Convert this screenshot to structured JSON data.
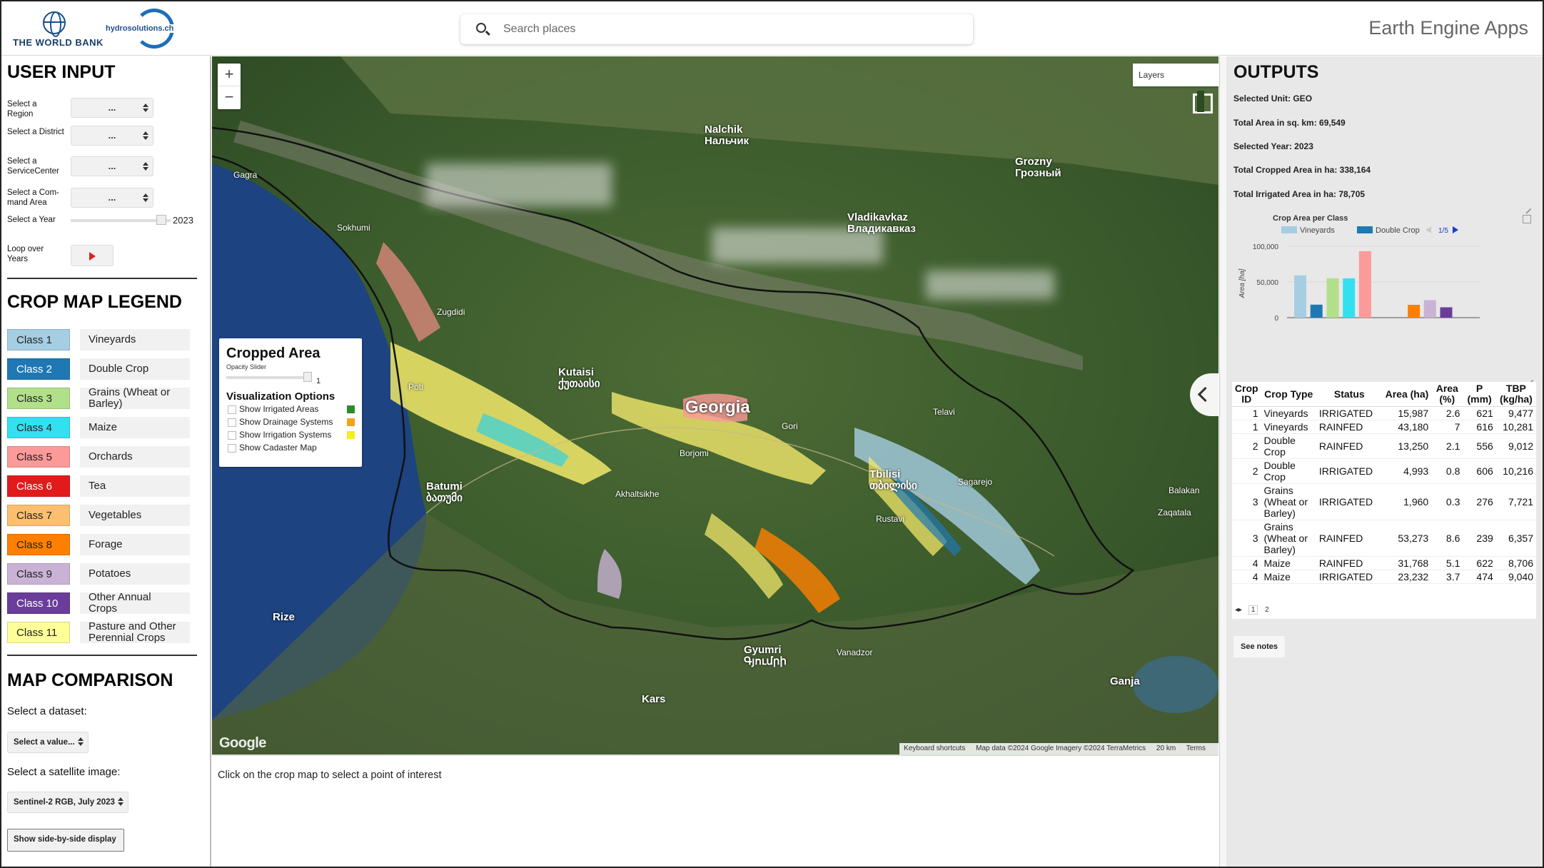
{
  "header": {
    "org1": "THE WORLD BANK",
    "org2": "hydrosolutions.ch",
    "search_placeholder": "Search places",
    "app_title": "Earth Engine Apps"
  },
  "user_input": {
    "title": "USER INPUT",
    "region_label": "Select a Region",
    "region_value": "...",
    "district_label": "Select a District",
    "district_value": "...",
    "service_label": "Select a ServiceCenter",
    "service_value": "...",
    "command_label": "Select a Com-mand Area",
    "command_value": "...",
    "year_label": "Select a Year",
    "year_value": "2023",
    "loop_label": "Loop over Years"
  },
  "legend": {
    "title": "CROP MAP LEGEND",
    "items": [
      {
        "cls": "Class 1",
        "name": "Vineyards",
        "color": "#a6cee3",
        "text_color": "#222"
      },
      {
        "cls": "Class 2",
        "name": "Double Crop",
        "color": "#1f78b4",
        "text_color": "#fff"
      },
      {
        "cls": "Class 3",
        "name": "Grains (Wheat or Barley)",
        "color": "#b2df8a",
        "text_color": "#222"
      },
      {
        "cls": "Class 4",
        "name": "Maize",
        "color": "#33e0f0",
        "text_color": "#222"
      },
      {
        "cls": "Class 5",
        "name": "Orchards",
        "color": "#fb9a99",
        "text_color": "#222"
      },
      {
        "cls": "Class 6",
        "name": "Tea",
        "color": "#e31a1c",
        "text_color": "#fff"
      },
      {
        "cls": "Class 7",
        "name": "Vegetables",
        "color": "#fdbf6f",
        "text_color": "#222"
      },
      {
        "cls": "Class 8",
        "name": "Forage",
        "color": "#ff7f00",
        "text_color": "#222"
      },
      {
        "cls": "Class 9",
        "name": "Potatoes",
        "color": "#cab2d6",
        "text_color": "#222"
      },
      {
        "cls": "Class 10",
        "name": "Other Annual Crops",
        "color": "#6a3d9a",
        "text_color": "#fff"
      },
      {
        "cls": "Class 11",
        "name": "Pasture and Other Perennial Crops",
        "color": "#ffff99",
        "text_color": "#222"
      }
    ]
  },
  "comparison": {
    "title": "MAP COMPARISON",
    "dataset_label": "Select a dataset:",
    "dataset_value": "Select a value...",
    "satellite_label": "Select a satellite image:",
    "satellite_value": "Sentinel-2 RGB, July 2023",
    "button": "Show side-by-side display"
  },
  "map": {
    "layers_label": "Layers",
    "country": "Georgia",
    "google": "Google",
    "attribution": [
      "Keyboard shortcuts",
      "Map data ©2024 Google Imagery ©2024 TerraMetrics",
      "20 km",
      "Terms"
    ],
    "cities": [
      {
        "name": "Kutaisi\nქუთაისი",
        "big": true
      },
      {
        "name": "Tbilisi\nთბილისი",
        "big": true
      },
      {
        "name": "Batumi\nბათუმი",
        "big": true
      },
      {
        "name": "Nalchik\nНальчик",
        "big": true
      },
      {
        "name": "Vladikavkaz\nВладикавказ",
        "big": true
      },
      {
        "name": "Grozny\nГрозный",
        "big": true
      },
      {
        "name": "Gyumri\nԳյումրի",
        "big": true
      },
      {
        "name": "Kars",
        "big": true
      },
      {
        "name": "Ganja",
        "big": true
      },
      {
        "name": "Rize",
        "big": true
      },
      {
        "name": "Sokhumi",
        "big": false
      },
      {
        "name": "Gagra",
        "big": false
      },
      {
        "name": "Zugdidi",
        "big": false
      },
      {
        "name": "Poti",
        "big": false
      },
      {
        "name": "Borjomi",
        "big": false
      },
      {
        "name": "Akhaltsikhe",
        "big": false
      },
      {
        "name": "Gori",
        "big": false
      },
      {
        "name": "Telavi",
        "big": false
      },
      {
        "name": "Sagarejo",
        "big": false
      },
      {
        "name": "Rustavi",
        "big": false
      },
      {
        "name": "Zaqatala",
        "big": false
      },
      {
        "name": "Balakan",
        "big": false
      },
      {
        "name": "Vanadzor",
        "big": false
      }
    ]
  },
  "crop_panel": {
    "title": "Cropped Area",
    "opacity_label": "Opacity Slider",
    "opacity_value": "1",
    "vis_title": "Visualization Options",
    "options": [
      {
        "label": "Show Irrigated Areas",
        "color": "#2a8c2a"
      },
      {
        "label": "Show Drainage Systems",
        "color": "#f5a21b"
      },
      {
        "label": "Show Irrigation Systems",
        "color": "#f5ee1b"
      },
      {
        "label": "Show Cadaster Map",
        "color": ""
      }
    ]
  },
  "console": {
    "text": "Click on the crop map to select a point of interest"
  },
  "outputs": {
    "title": "OUTPUTS",
    "unit": "Selected Unit: GEO",
    "total_area": "Total Area in sq. km: 69,549",
    "year": "Selected Year: 2023",
    "cropped": "Total Cropped Area in ha: 338,164",
    "irrigated": "Total Irrigated Area in ha: 78,705",
    "notes_button": "See notes"
  },
  "chart_data": {
    "type": "bar",
    "title": "Crop Area per Class",
    "ylabel": "Area [ha]",
    "ylim": [
      0,
      100000
    ],
    "yticks": [
      "0",
      "50,000",
      "100,000"
    ],
    "legend_visible": [
      "Vineyards",
      "Double Crop"
    ],
    "legend_page": "1/5",
    "categories": [
      "Vineyards",
      "Double Crop",
      "Grains (Wheat or Barley)",
      "Maize",
      "Orchards",
      "Tea",
      "Vegetables",
      "Forage",
      "Potatoes",
      "Other Annual Crops",
      "Pasture and Other Perennial Crops"
    ],
    "colors": [
      "#a6cee3",
      "#1f78b4",
      "#b2df8a",
      "#33e0f0",
      "#fb9a99",
      "#e31a1c",
      "#fdbf6f",
      "#ff7f00",
      "#cab2d6",
      "#6a3d9a",
      "#ffff99"
    ],
    "values": [
      59167,
      18243,
      55233,
      55000,
      93000,
      0,
      0,
      18000,
      24500,
      14500,
      0
    ]
  },
  "table": {
    "headers": [
      "Crop ID",
      "Crop Type",
      "Status",
      "Area (ha)",
      "Area (%)",
      "P (mm)",
      "TBP (kg/ha)"
    ],
    "rows": [
      [
        "1",
        "Vineyards",
        "IRRIGATED",
        "15,987",
        "2.6",
        "621",
        "9,477"
      ],
      [
        "1",
        "Vineyards",
        "RAINFED",
        "43,180",
        "7",
        "616",
        "10,281"
      ],
      [
        "2",
        "Double Crop",
        "RAINFED",
        "13,250",
        "2.1",
        "556",
        "9,012"
      ],
      [
        "2",
        "Double Crop",
        "IRRIGATED",
        "4,993",
        "0.8",
        "606",
        "10,216"
      ],
      [
        "3",
        "Grains (Wheat or Barley)",
        "IRRIGATED",
        "1,960",
        "0.3",
        "276",
        "7,721"
      ],
      [
        "3",
        "Grains (Wheat or Barley)",
        "RAINFED",
        "53,273",
        "8.6",
        "239",
        "6,357"
      ],
      [
        "4",
        "Maize",
        "RAINFED",
        "31,768",
        "5.1",
        "622",
        "8,706"
      ],
      [
        "4",
        "Maize",
        "IRRIGATED",
        "23,232",
        "3.7",
        "474",
        "9,040"
      ]
    ],
    "pages": [
      "1",
      "2"
    ]
  }
}
